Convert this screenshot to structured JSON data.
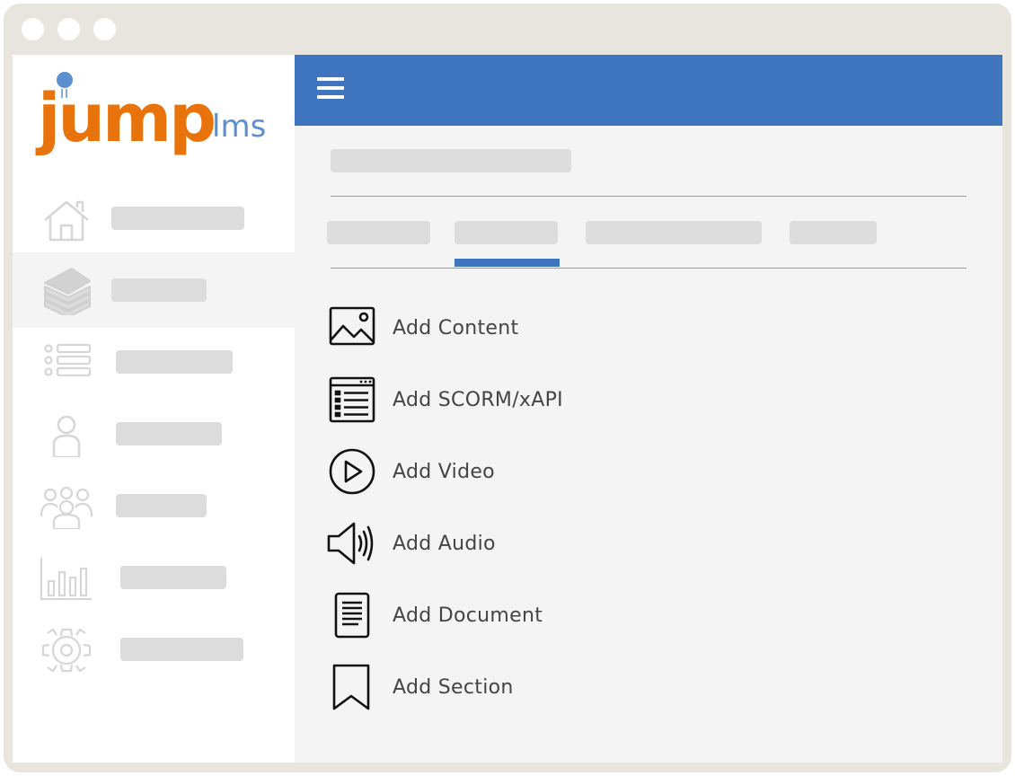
{
  "logo": {
    "word": "jump",
    "suffix": "lms"
  },
  "sidebar": {
    "items": [
      {
        "icon": "home-icon"
      },
      {
        "icon": "books-icon",
        "active": true
      },
      {
        "icon": "list-icon"
      },
      {
        "icon": "user-icon"
      },
      {
        "icon": "group-icon"
      },
      {
        "icon": "bar-chart-icon"
      },
      {
        "icon": "gear-icon"
      }
    ]
  },
  "colors": {
    "brand_blue": "#3f74bf",
    "brand_orange": "#e8730c",
    "frame": "#e8e5de",
    "placeholder": "#dcdcdc"
  },
  "main": {
    "actions": [
      {
        "label": "Add Content",
        "icon": "image-icon"
      },
      {
        "label": "Add SCORM/xAPI",
        "icon": "scorm-window-icon"
      },
      {
        "label": "Add Video",
        "icon": "play-circle-icon"
      },
      {
        "label": "Add Audio",
        "icon": "speaker-icon"
      },
      {
        "label": "Add Document",
        "icon": "document-icon"
      },
      {
        "label": "Add Section",
        "icon": "bookmark-icon"
      }
    ],
    "active_tab_index": 1
  }
}
